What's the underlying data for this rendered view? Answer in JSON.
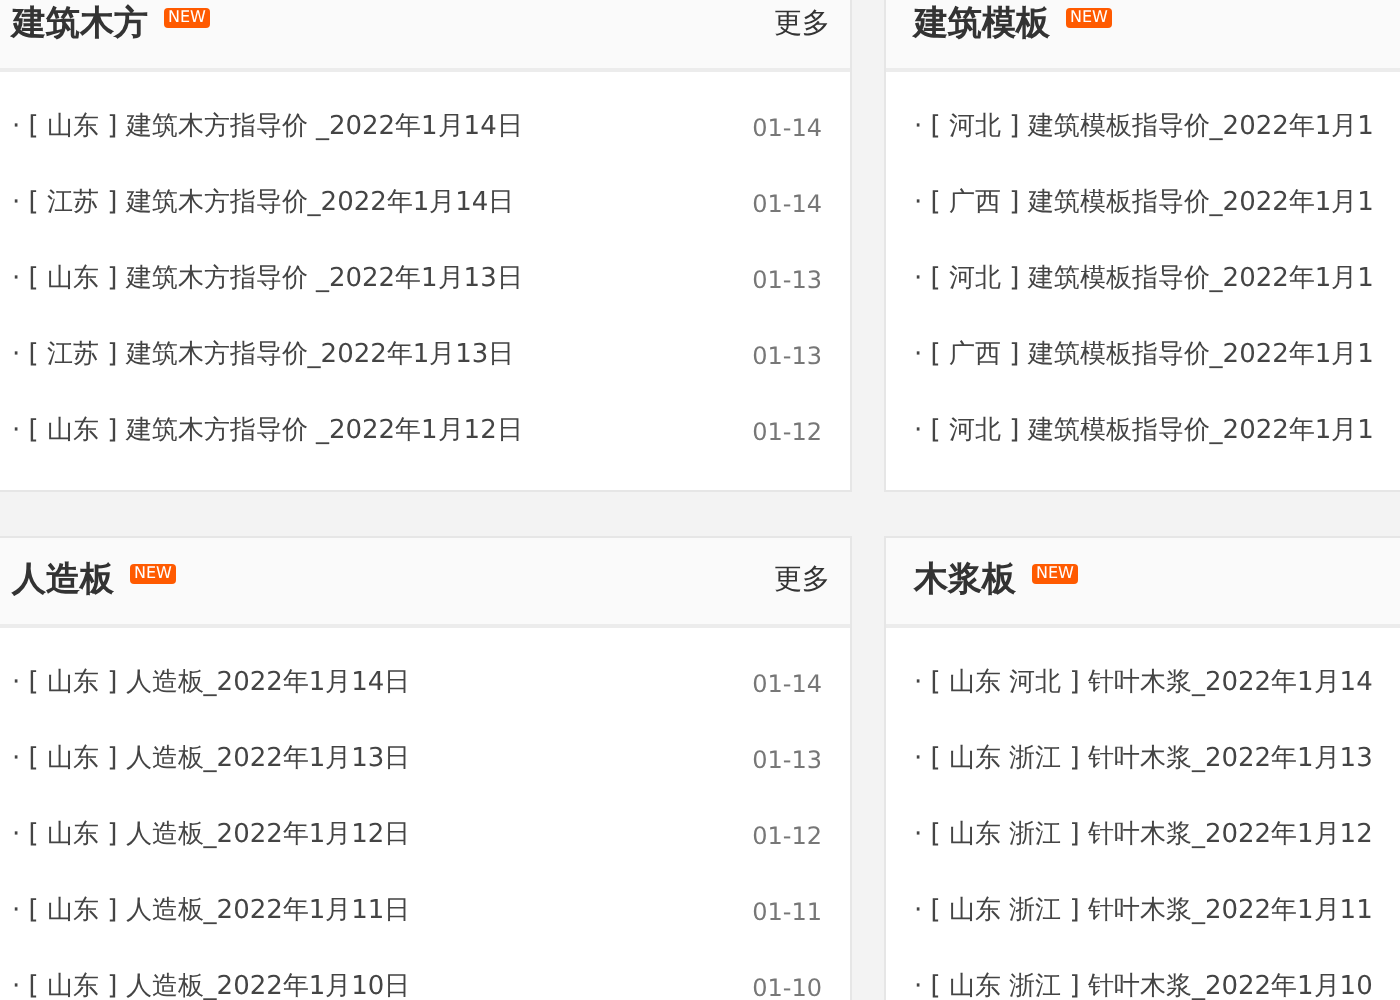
{
  "panels": [
    {
      "title": "建筑木方",
      "badge": "NEW",
      "more": "更多",
      "items": [
        {
          "title": "· [ 山东 ] 建筑木方指导价 _2022年1月14日",
          "date": "01-14"
        },
        {
          "title": "· [ 江苏 ] 建筑木方指导价_2022年1月14日",
          "date": "01-14"
        },
        {
          "title": "· [ 山东 ] 建筑木方指导价 _2022年1月13日",
          "date": "01-13"
        },
        {
          "title": "· [ 江苏 ] 建筑木方指导价_2022年1月13日",
          "date": "01-13"
        },
        {
          "title": "· [ 山东 ] 建筑木方指导价 _2022年1月12日",
          "date": "01-12"
        }
      ]
    },
    {
      "title": "建筑模板",
      "badge": "NEW",
      "items": [
        {
          "title": "· [ 河北 ] 建筑模板指导价_2022年1月1"
        },
        {
          "title": "· [ 广西 ] 建筑模板指导价_2022年1月1"
        },
        {
          "title": "· [ 河北 ] 建筑模板指导价_2022年1月1"
        },
        {
          "title": "· [ 广西 ] 建筑模板指导价_2022年1月1"
        },
        {
          "title": "· [ 河北 ] 建筑模板指导价_2022年1月1"
        }
      ]
    },
    {
      "title": "人造板",
      "badge": "NEW",
      "more": "更多",
      "items": [
        {
          "title": "· [ 山东 ] 人造板_2022年1月14日",
          "date": "01-14"
        },
        {
          "title": "· [ 山东 ] 人造板_2022年1月13日",
          "date": "01-13"
        },
        {
          "title": "· [ 山东 ] 人造板_2022年1月12日",
          "date": "01-12"
        },
        {
          "title": "· [ 山东 ] 人造板_2022年1月11日",
          "date": "01-11"
        },
        {
          "title": "· [ 山东 ] 人造板_2022年1月10日",
          "date": "01-10"
        }
      ]
    },
    {
      "title": "木浆板",
      "badge": "NEW",
      "items": [
        {
          "title": "· [ 山东 河北 ] 针叶木浆_2022年1月14"
        },
        {
          "title": "· [ 山东 浙江 ] 针叶木浆_2022年1月13"
        },
        {
          "title": "· [ 山东 浙江 ] 针叶木浆_2022年1月12"
        },
        {
          "title": "· [ 山东 浙江 ] 针叶木浆_2022年1月11"
        },
        {
          "title": "· [ 山东 浙江 ] 针叶木浆_2022年1月10"
        }
      ]
    }
  ]
}
